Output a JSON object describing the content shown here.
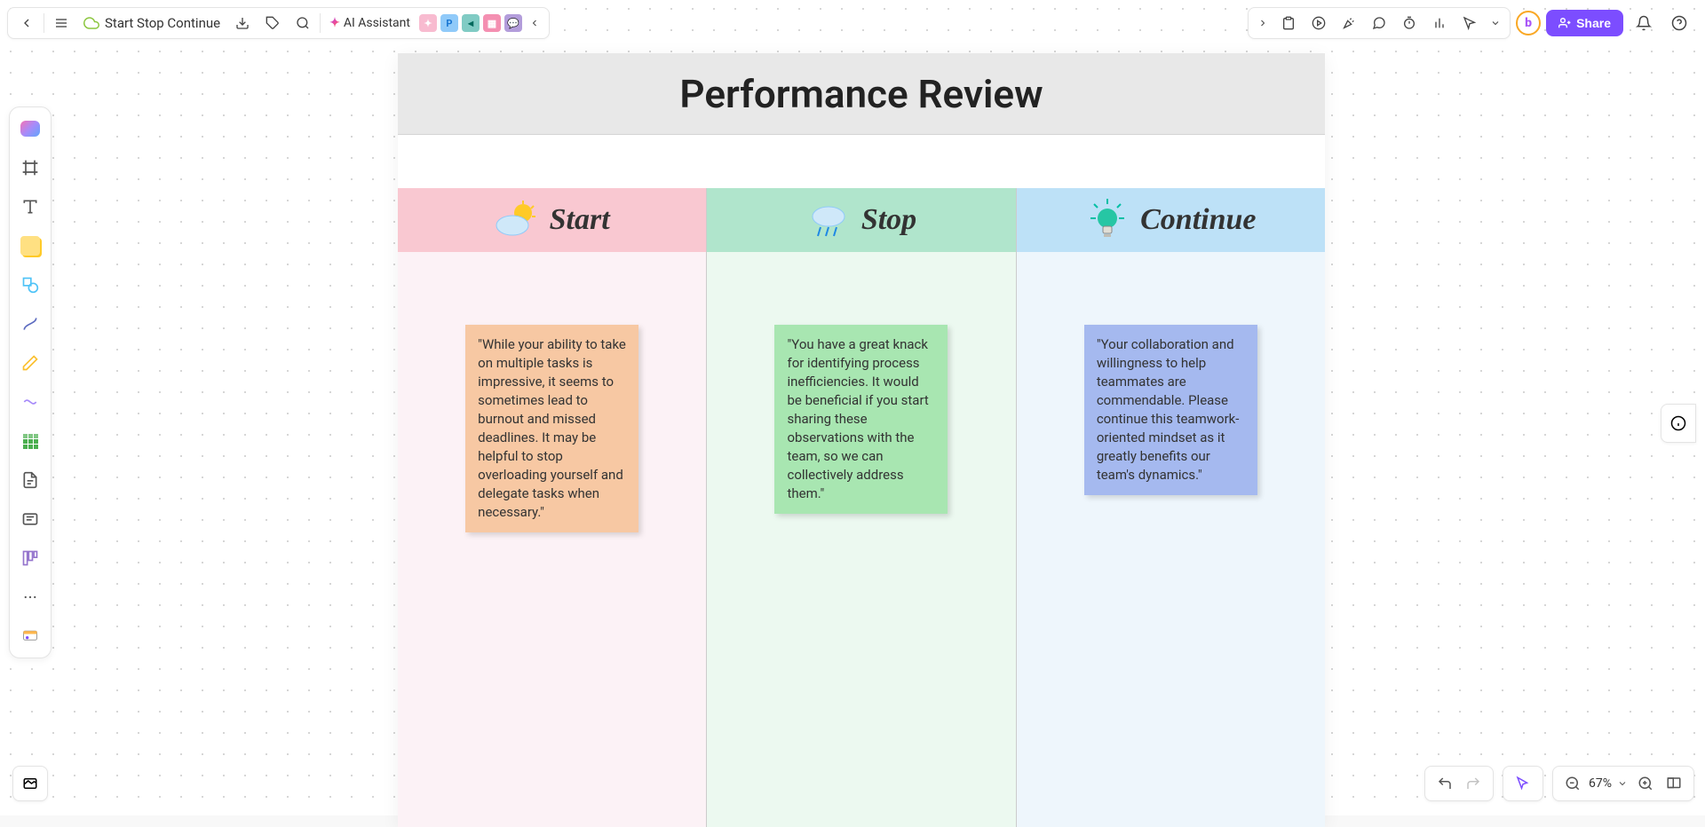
{
  "topbar": {
    "doc_name": "Start Stop Continue",
    "ai_label": "AI Assistant",
    "share_label": "Share",
    "chips": [
      "",
      "P",
      "",
      "",
      ""
    ]
  },
  "board": {
    "title": "Performance Review",
    "columns": [
      {
        "label": "Start",
        "note": "\"While your ability to take on multiple tasks is impressive, it seems to sometimes lead to burnout and missed deadlines. It may be helpful to stop overloading yourself and delegate tasks when necessary.\""
      },
      {
        "label": "Stop",
        "note": "\"You have a great knack for identifying process inefficiencies. It would be beneficial if you start sharing these observations with the team, so we can collectively address them.\""
      },
      {
        "label": "Continue",
        "note": "\"Your collaboration and willingness to help teammates are commendable. Please continue this teamwork-oriented mindset as it greatly benefits our team's dynamics.\""
      }
    ]
  },
  "zoom": {
    "value": "67%"
  },
  "avatar": "b"
}
